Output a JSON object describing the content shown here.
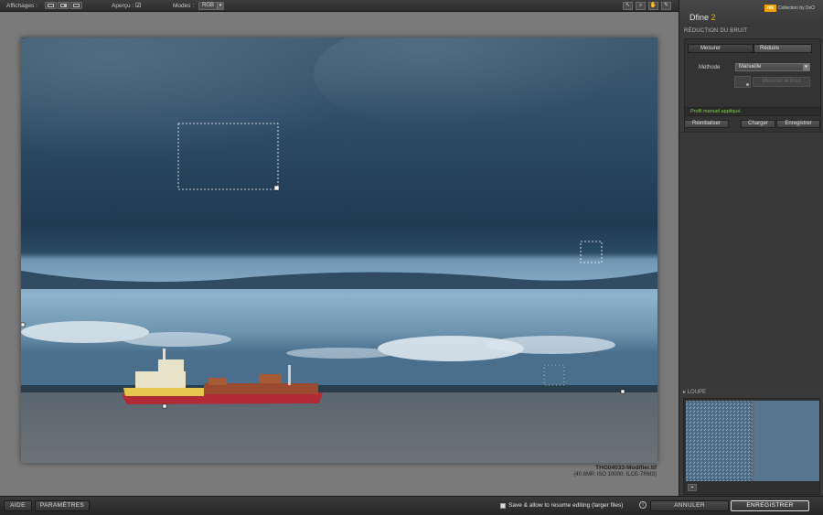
{
  "toolbar": {
    "affichages_label": "Affichages :",
    "apercu_label": "Aperçu :",
    "modes_label": "Modes :",
    "mode_value": "RGB"
  },
  "photo": {
    "filename": "THG04033-Modifier.tif",
    "meta": "(40,6MP, ISO 10000, ILCE-7RM3)"
  },
  "panel": {
    "app_name": "Dfine",
    "app_version": "2",
    "collection": "Collection by DxO",
    "section_title": "RÉDUCTION DU BRUIT",
    "tab_mesurer": "Mesurer",
    "tab_reduire": "Réduire",
    "methode_label": "Méthode",
    "methode_value": "Manuelle",
    "mesurer_bruit": "Mesurer le bruit",
    "status": "Profil manuel appliqué.",
    "btn_reinit": "Réinitialiser",
    "btn_charger": "Charger",
    "btn_enregistrer": "Enregistrer",
    "loupe_label": "LOUPE"
  },
  "bottom": {
    "aide": "AIDE",
    "parametres": "PARAMÈTRES",
    "save_resume": "Save & allow to resume editing (larger files)",
    "annuler": "ANNULER",
    "enregistrer": "ENREGISTRER"
  },
  "colors": {
    "status_green": "#7fd33a",
    "version_accent": "#f0b400"
  }
}
